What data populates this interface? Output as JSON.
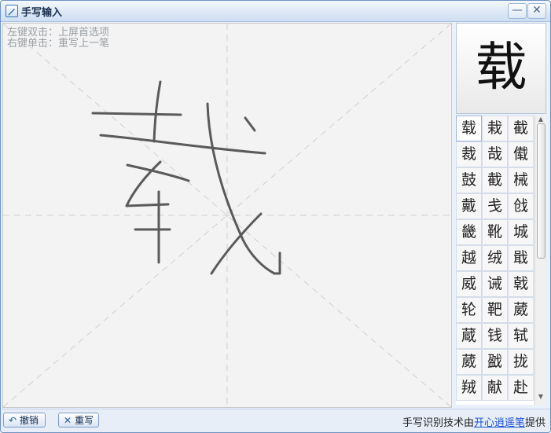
{
  "window": {
    "title": "手写输入",
    "minimize_glyph": "—",
    "close_glyph": "✕"
  },
  "canvas": {
    "hint_line1": "左键双击：上屏首选项",
    "hint_line2": "右键单击：重写上一笔"
  },
  "preview": {
    "character": "载"
  },
  "candidates": [
    "载",
    "栽",
    "截",
    "裁",
    "哉",
    "傤",
    "鼓",
    "截",
    "械",
    "戴",
    "戋",
    "戗",
    "畿",
    "靴",
    "城",
    "越",
    "绒",
    "戢",
    "威",
    "诫",
    "戟",
    "轮",
    "靶",
    "葳",
    "蔵",
    "钱",
    "轼",
    "葳",
    "戤",
    "拢",
    "羢",
    "献",
    "赴"
  ],
  "footer": {
    "undo_label": "撤销",
    "undo_icon": "undo-icon",
    "rewrite_label": "重写",
    "rewrite_icon": "x-icon",
    "credit_prefix": "手写识别技术由",
    "credit_link": "开心逍遥笔",
    "credit_suffix": "提供"
  },
  "colors": {
    "ink": "#5a5a5a",
    "guide": "#cfcfcf",
    "link": "#1a4fd6"
  }
}
